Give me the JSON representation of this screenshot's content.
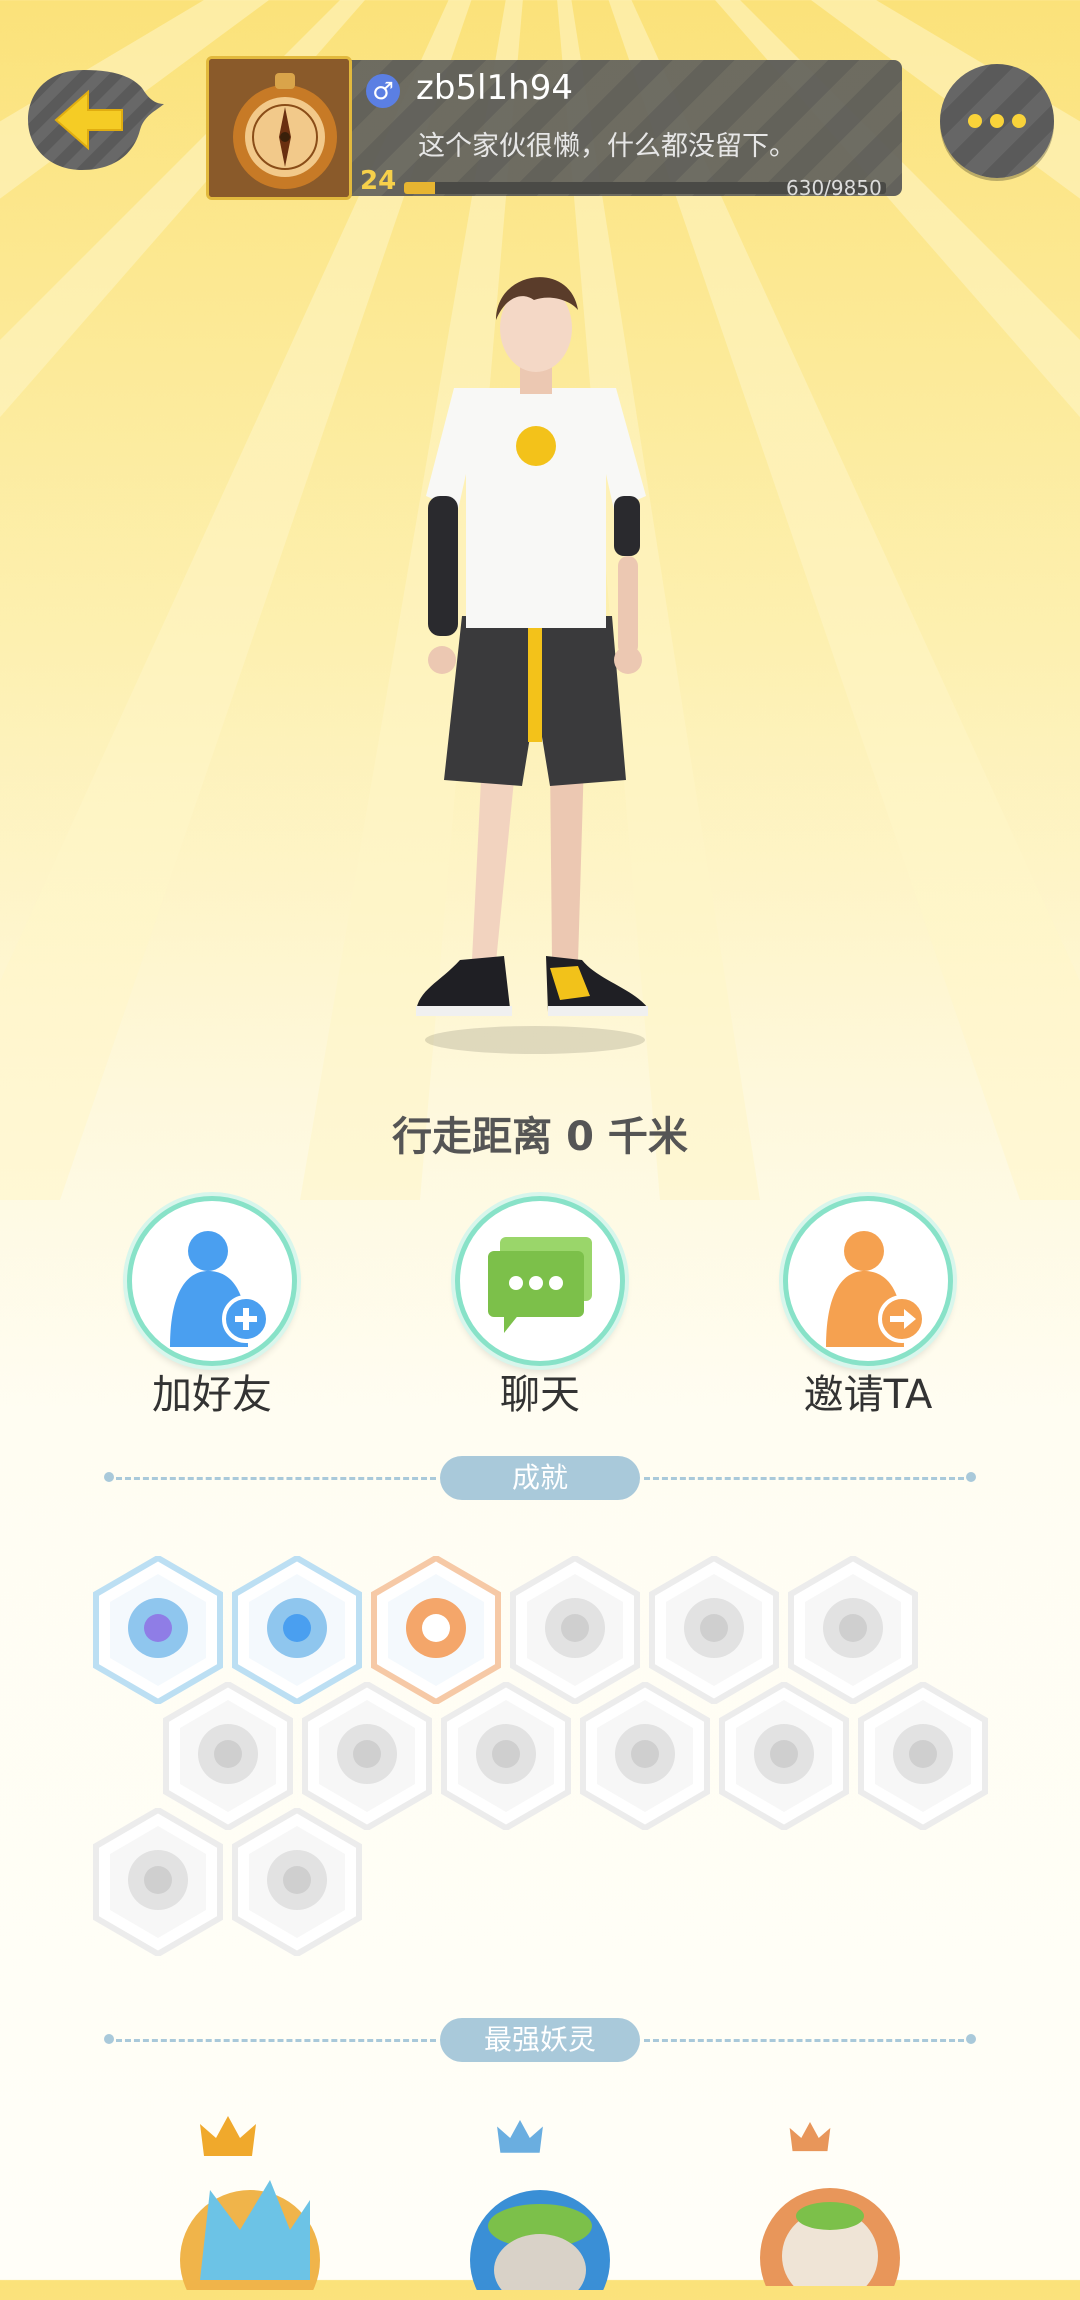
{
  "header": {
    "username": "zb5l1h94",
    "gender_symbol": "♂",
    "bio": "这个家伙很懒，什么都没留下。",
    "level": "24",
    "xp_text": "630/9850",
    "xp_progress": 0.064,
    "back_icon": "arrow-left-icon",
    "more_icon": "more-dots-icon"
  },
  "character": {
    "distance_text": "行走距离 0 千米"
  },
  "actions": [
    {
      "label": "加好友",
      "icon": "add-friend-icon",
      "color": "#4a9ff0"
    },
    {
      "label": "聊天",
      "icon": "chat-icon",
      "color": "#7cc04a"
    },
    {
      "label": "邀请TA",
      "icon": "invite-icon",
      "color": "#f5a150"
    }
  ],
  "sections": {
    "achievements_title": "成就",
    "strongest_title": "最强妖灵"
  },
  "achievements": [
    {
      "icon": "magic-staff-icon",
      "unlocked": true
    },
    {
      "icon": "cat-spirit-icon",
      "unlocked": true
    },
    {
      "icon": "yinyang-book-icon",
      "unlocked": true
    },
    {
      "icon": "shoe-icon",
      "unlocked": false
    },
    {
      "icon": "moon-icon",
      "unlocked": false
    },
    {
      "icon": "orb-icon",
      "unlocked": false
    },
    {
      "icon": "egg-icon",
      "unlocked": false
    },
    {
      "icon": "yinyang-icon",
      "unlocked": false
    },
    {
      "icon": "creature-icon",
      "unlocked": false
    },
    {
      "icon": "cart-icon",
      "unlocked": false
    },
    {
      "icon": "bear-icon",
      "unlocked": false
    },
    {
      "icon": "dragon-icon",
      "unlocked": false
    },
    {
      "icon": "safe-icon",
      "unlocked": false
    },
    {
      "icon": "book-fox-icon",
      "unlocked": false
    }
  ],
  "strongest_spirits": [
    {
      "crown": "gold-crown-icon",
      "crown_color": "#f0a92c"
    },
    {
      "crown": "blue-crown-icon",
      "crown_color": "#6aaee0"
    },
    {
      "crown": "bronze-crown-icon",
      "crown_color": "#e8965a"
    }
  ]
}
